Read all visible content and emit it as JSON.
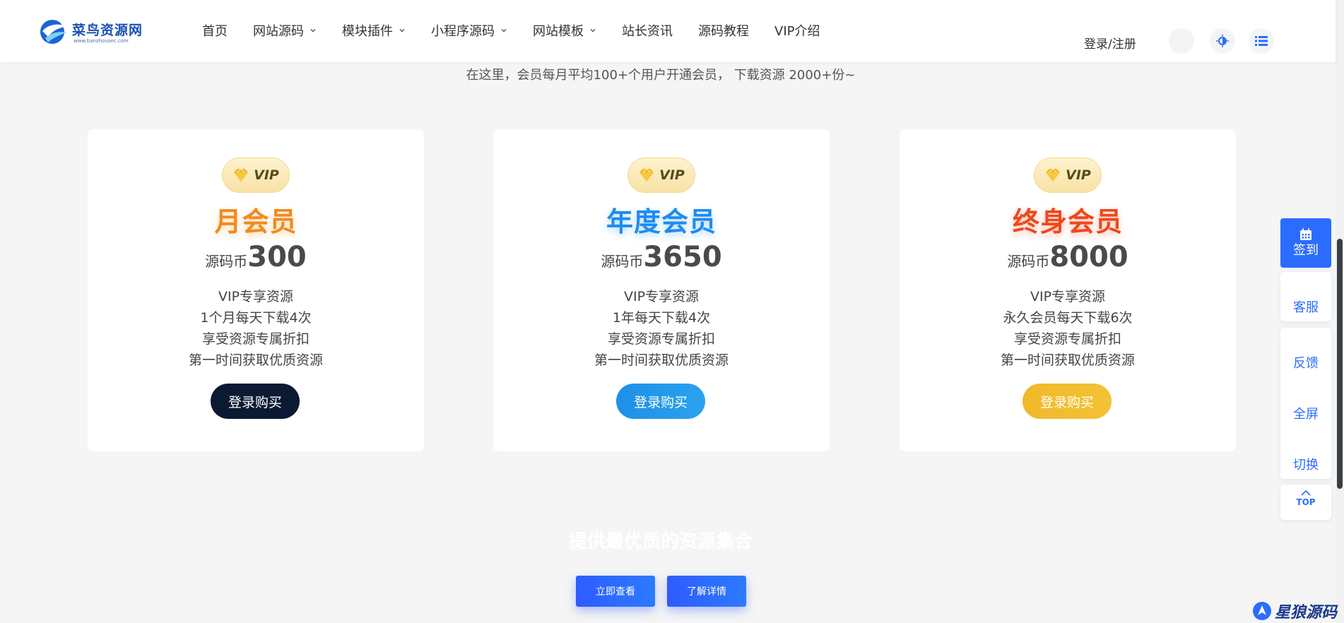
{
  "header": {
    "logo_title": "菜鸟资源网",
    "logo_sub": "www.banzhousec.com",
    "nav": [
      {
        "label": "首页",
        "dropdown": false
      },
      {
        "label": "网站源码",
        "dropdown": true
      },
      {
        "label": "模块插件",
        "dropdown": true
      },
      {
        "label": "小程序源码",
        "dropdown": true
      },
      {
        "label": "网站模板",
        "dropdown": true
      },
      {
        "label": "站长资讯",
        "dropdown": false
      },
      {
        "label": "源码教程",
        "dropdown": false
      },
      {
        "label": "VIP介绍",
        "dropdown": false
      }
    ],
    "login_label": "登录/注册"
  },
  "intro": "在这里，会员每月平均100+个用户开通会员， 下载资源 2000+份~",
  "plans": [
    {
      "badge": "VIP",
      "title": "月会员",
      "title_color": "#f28a1c",
      "price_unit": "源码币",
      "price": "300",
      "features": [
        "VIP专享资源",
        "1个月每天下载4次",
        "享受资源专属折扣",
        "第一时间获取优质资源"
      ],
      "button": "登录购买",
      "button_color": "#0b1a33"
    },
    {
      "badge": "VIP",
      "title": "年度会员",
      "title_color": "#1e8cf0",
      "price_unit": "源码币",
      "price": "3650",
      "features": [
        "VIP专享资源",
        "1年每天下载4次",
        "享受资源专属折扣",
        "第一时间获取优质资源"
      ],
      "button": "登录购买",
      "button_color": "#1e8fe6"
    },
    {
      "badge": "VIP",
      "title": "终身会员",
      "title_color": "#f2461c",
      "price_unit": "源码币",
      "price": "8000",
      "features": [
        "VIP专享资源",
        "永久会员每天下载6次",
        "享受资源专属折扣",
        "第一时间获取优质资源"
      ],
      "button": "登录购买",
      "button_color": "#f3c234"
    }
  ],
  "cta": {
    "title": "提供最优质的资源集合",
    "primary": "立即查看",
    "secondary": "了解详情"
  },
  "float_bar": {
    "signin": "签到",
    "service": "客服",
    "feedback": "反馈",
    "fullscreen": "全屏",
    "switch": "切换",
    "top": "TOP"
  },
  "watermark": "星狼源码",
  "colors": {
    "accent": "#2b6cff",
    "page_bg": "#f5f5f5"
  }
}
